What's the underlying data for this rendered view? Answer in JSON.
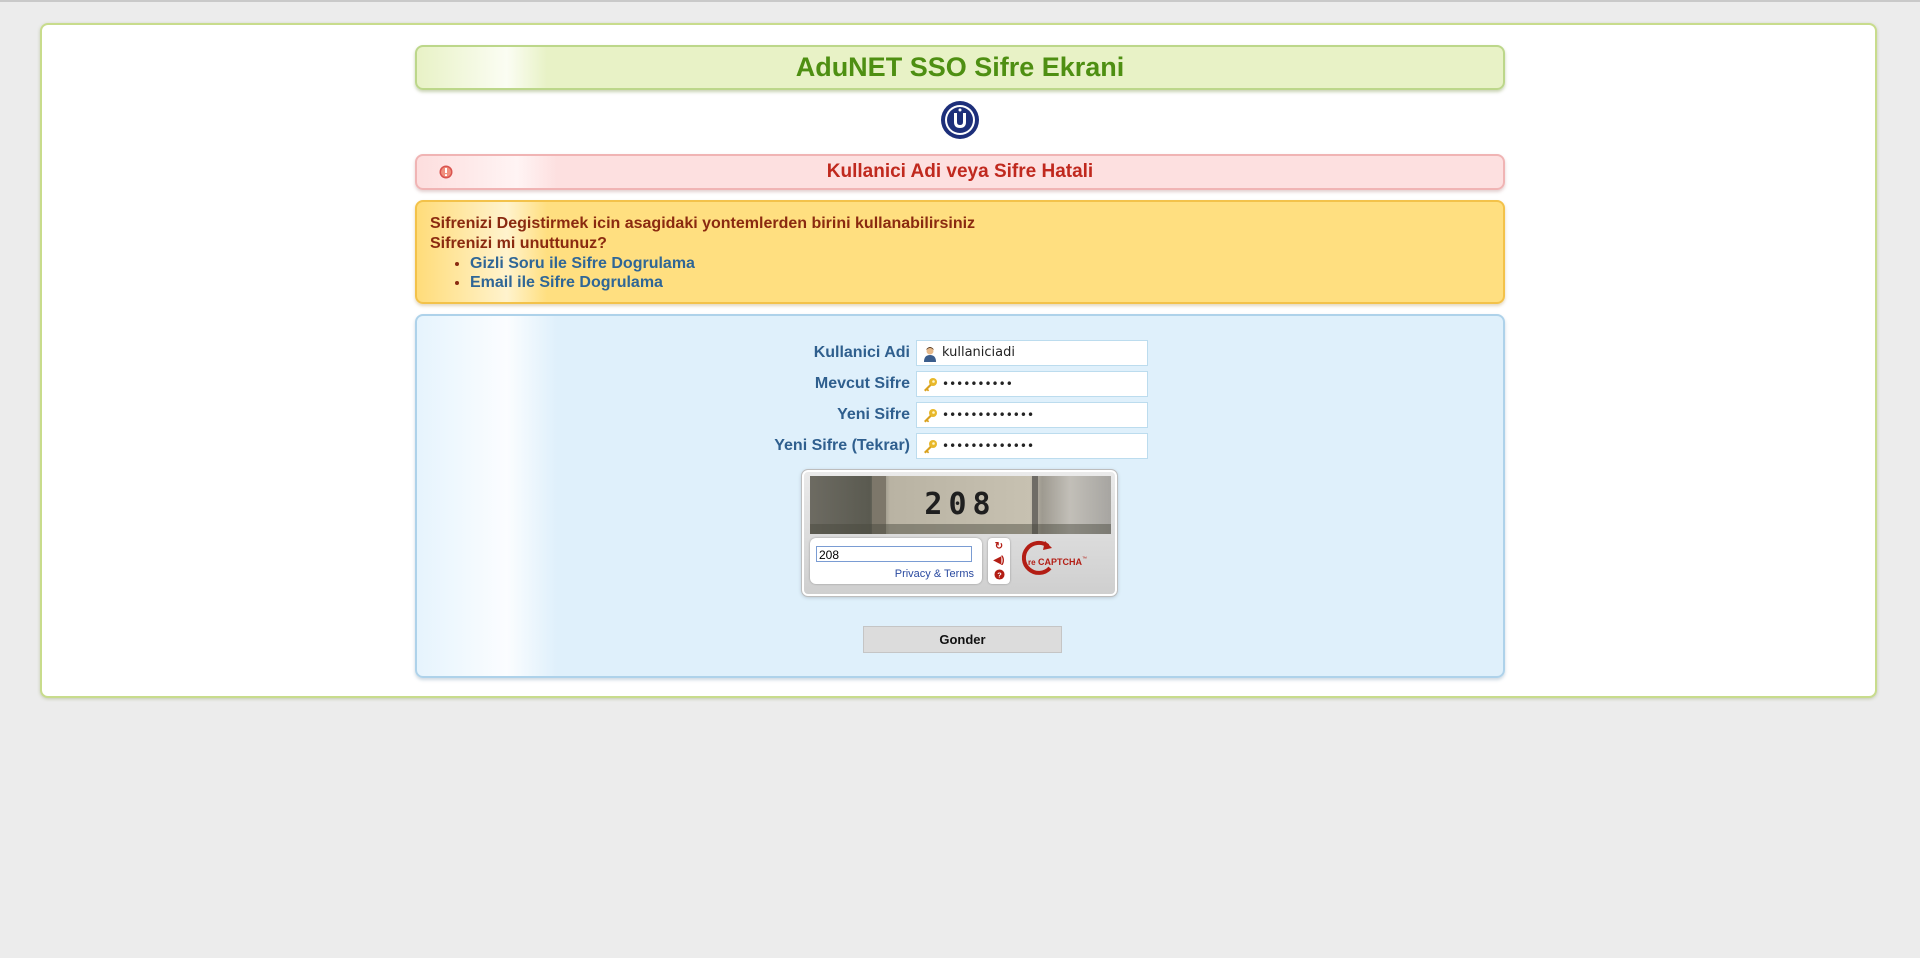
{
  "header": {
    "title": "AduNET SSO Sifre Ekrani",
    "logo_icon": "university-seal-icon"
  },
  "error": {
    "icon": "warning-icon",
    "message": "Kullanici Adi veya Sifre Hatali"
  },
  "info": {
    "line1": "Sifrenizi Degistirmek icin asagidaki yontemlerden birini kullanabilirsiniz",
    "line2": "Sifrenizi mi unuttunuz?",
    "links": [
      "Gizli Soru ile Sifre Dogrulama",
      "Email ile Sifre Dogrulama"
    ]
  },
  "form": {
    "username": {
      "label": "Kullanici Adi",
      "value": "kullaniciadi",
      "icon": "user-icon"
    },
    "current_password": {
      "label": "Mevcut Sifre",
      "value": "••••••••••",
      "icon": "key-icon"
    },
    "new_password": {
      "label": "Yeni Sifre",
      "value": "•••••••••••••",
      "icon": "key-icon"
    },
    "new_password_repeat": {
      "label": "Yeni Sifre (Tekrar)",
      "value": "•••••••••••••",
      "icon": "key-icon"
    },
    "submit_label": "Gonder"
  },
  "captcha": {
    "challenge_text": "208",
    "input_value": "208",
    "privacy_link": "Privacy & Terms",
    "buttons": [
      "refresh-icon",
      "audio-icon",
      "help-icon"
    ],
    "brand": "reCAPTCHA"
  },
  "colors": {
    "title_green": "#4e8f12",
    "error_red": "#c0291e",
    "label_blue": "#2f5f8e",
    "info_brown": "#8a2a10",
    "link_blue": "#2f6696"
  }
}
